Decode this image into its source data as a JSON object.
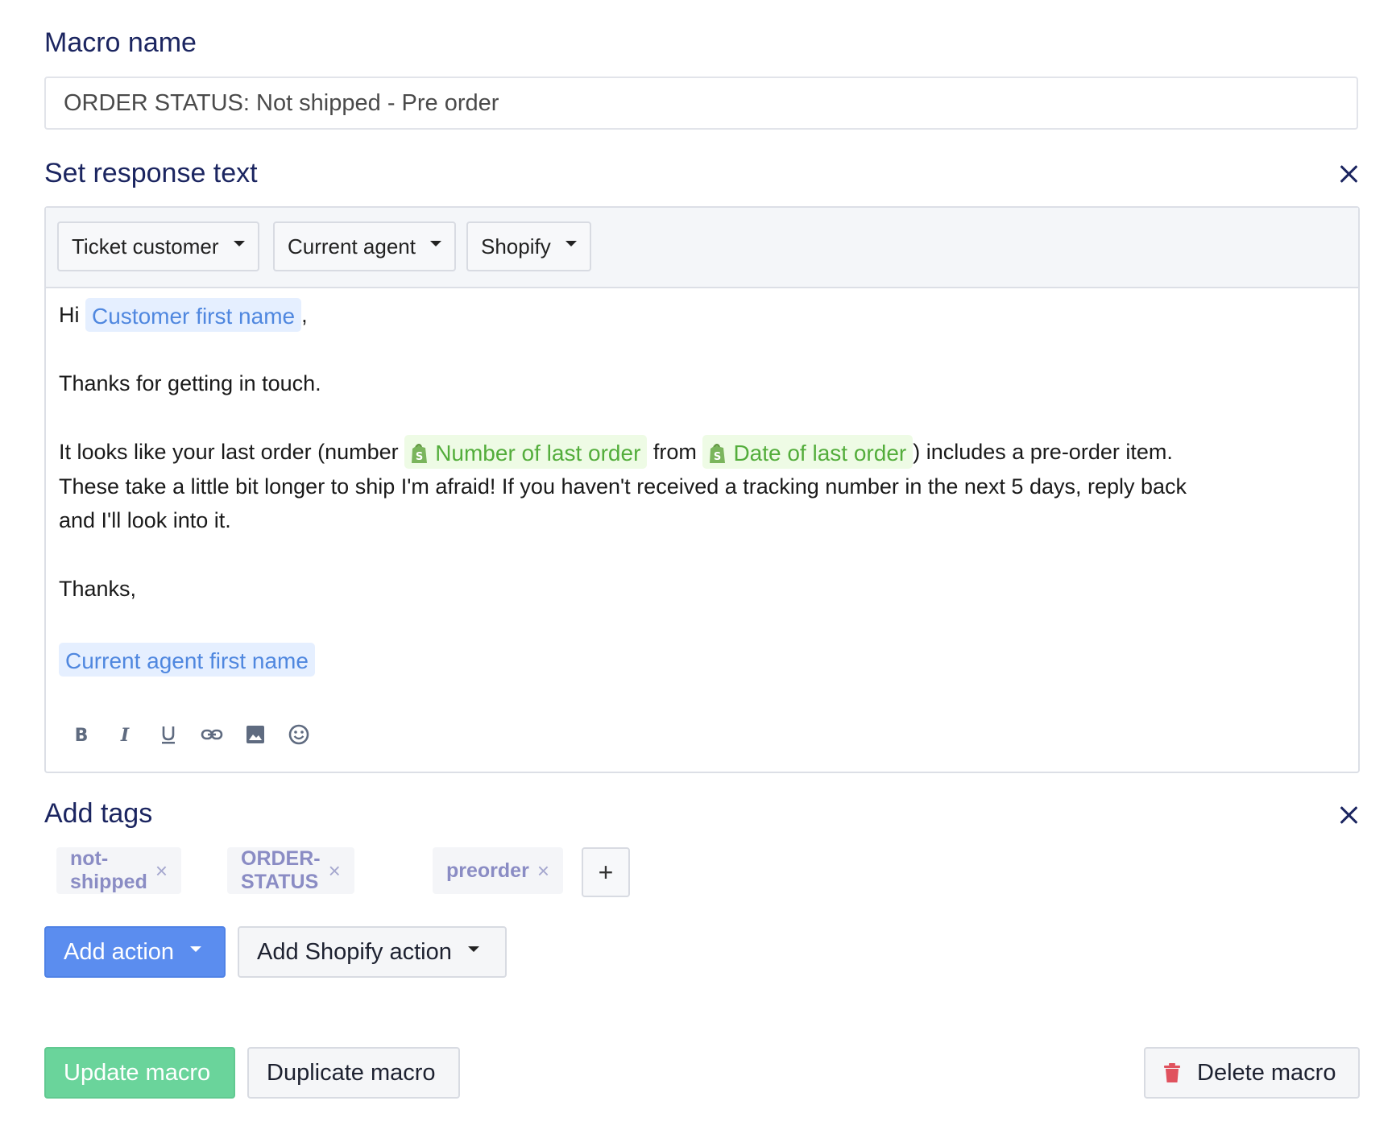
{
  "macro_name": {
    "label": "Macro name",
    "value": "ORDER STATUS: Not shipped - Pre order"
  },
  "response_text": {
    "title": "Set response text",
    "close_icon": "close-icon",
    "variables": [
      "Ticket customer",
      "Current agent",
      "Shopify"
    ],
    "body": {
      "greeting_prefix": "Hi",
      "customer_first_name": "Customer first name",
      "greeting_suffix": ",",
      "line_thanks": "Thanks for getting in touch.",
      "line3_prefix": "It looks like your last order (number",
      "number_of_last_order": "Number of last order",
      "line3_from": "from",
      "date_of_last_order": "Date of last order",
      "line3_suffix": ") includes a pre-order item.",
      "line4": "These take a little bit longer to ship I'm afraid! If you haven't received a tracking number in the next 5 days, reply back",
      "line5": "and I'll look into it.",
      "signoff": "Thanks,",
      "current_agent_first_name": "Current agent first name"
    },
    "format_icons": [
      "bold-icon",
      "italic-icon",
      "underline-icon",
      "link-icon",
      "image-icon",
      "emoji-icon"
    ]
  },
  "tags": {
    "title": "Add tags",
    "items": [
      "not-shipped",
      "ORDER-STATUS",
      "preorder"
    ],
    "remove_glyph": "×",
    "add_glyph": "+"
  },
  "actions": {
    "add_action": "Add action",
    "add_shopify_action": "Add Shopify action"
  },
  "footer": {
    "update": "Update macro",
    "duplicate": "Duplicate macro",
    "delete": "Delete macro"
  },
  "colors": {
    "heading": "#1b2560",
    "primary": "#5b8def",
    "success": "#6ad49b",
    "danger": "#e0525e",
    "variable_chip": "#e5efff",
    "shopify_chip": "#eefbe5"
  }
}
